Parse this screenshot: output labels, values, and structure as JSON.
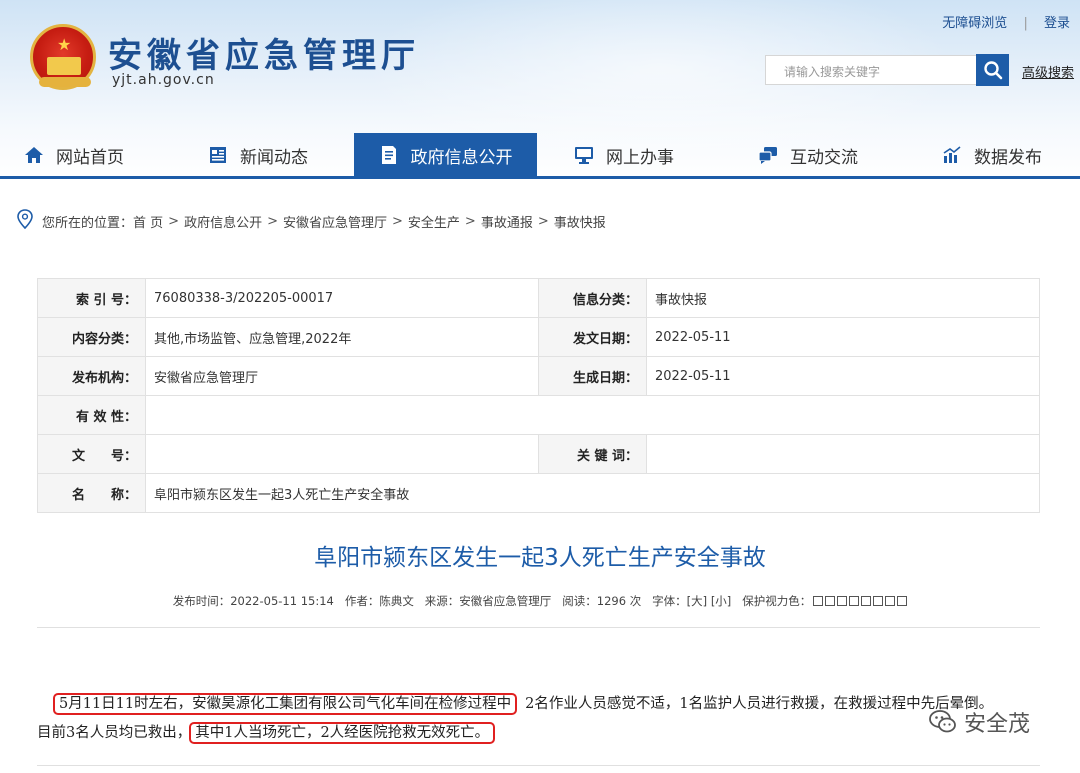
{
  "header": {
    "site_title": "安徽省应急管理厅",
    "site_domain": "yjt.ah.gov.cn",
    "accessible_link": "无障碍浏览",
    "separator": "|",
    "login_link": "登录",
    "search_placeholder": "请输入搜索关键字",
    "advanced_search": "高级搜索"
  },
  "nav": {
    "items": [
      {
        "label": "网站首页",
        "icon": "home-icon"
      },
      {
        "label": "新闻动态",
        "icon": "news-icon"
      },
      {
        "label": "政府信息公开",
        "icon": "document-icon"
      },
      {
        "label": "网上办事",
        "icon": "monitor-icon"
      },
      {
        "label": "互动交流",
        "icon": "chat-icon"
      },
      {
        "label": "数据发布",
        "icon": "chart-icon"
      }
    ],
    "active_index": 2,
    "accent_color": "#1d5ca8"
  },
  "breadcrumb": {
    "prefix": "您所在的位置：",
    "items": [
      "首 页",
      "政府信息公开",
      "安徽省应急管理厅",
      "安全生产",
      "事故通报",
      "事故快报"
    ],
    "arrow": ">"
  },
  "info": {
    "rows": [
      [
        {
          "label": "索 引 号：",
          "value": "76080338-3/202205-00017"
        },
        {
          "label": "信息分类：",
          "value": "事故快报"
        }
      ],
      [
        {
          "label": "内容分类：",
          "value": "其他,市场监管、应急管理,2022年"
        },
        {
          "label": "发文日期：",
          "value": "2022-05-11"
        }
      ],
      [
        {
          "label": "发布机构：",
          "value": "安徽省应急管理厅"
        },
        {
          "label": "生成日期：",
          "value": "2022-05-11"
        }
      ],
      [
        {
          "label": "有 效 性：",
          "value": ""
        }
      ],
      [
        {
          "label": "文　　号：",
          "value": ""
        },
        {
          "label": "关 键 词：",
          "value": ""
        }
      ],
      [
        {
          "label": "名　　称：",
          "value": "阜阳市颍东区发生一起3人死亡生产安全事故"
        }
      ]
    ]
  },
  "article": {
    "title": "阜阳市颍东区发生一起3人死亡生产安全事故",
    "meta": {
      "publish_label": "发布时间：",
      "publish_time": "2022-05-11 15:14",
      "author_label": "作者：",
      "author": "陈典文",
      "source_label": "来源：",
      "source": "安徽省应急管理厅",
      "views_label": "阅读：",
      "views": "1296 次",
      "font_label": "字体：",
      "font_large": "[大]",
      "font_small": "[小]",
      "eye_label": "保护视力色："
    },
    "para1_highlight": "5月11日11时左右，安徽昊源化工集团有限公司气化车间在检修过程中",
    "para1_rest": "2名作业人员感觉不适，1名监护人员进行救援，在救援过程中先后晕倒。",
    "para2_start": "目前3名人员均已救出，",
    "para2_highlight": "其中1人当场死亡，2人经医院抢救无效死亡。",
    "highlight_color": "#e02020"
  },
  "watermark": {
    "text": "安全茂"
  }
}
